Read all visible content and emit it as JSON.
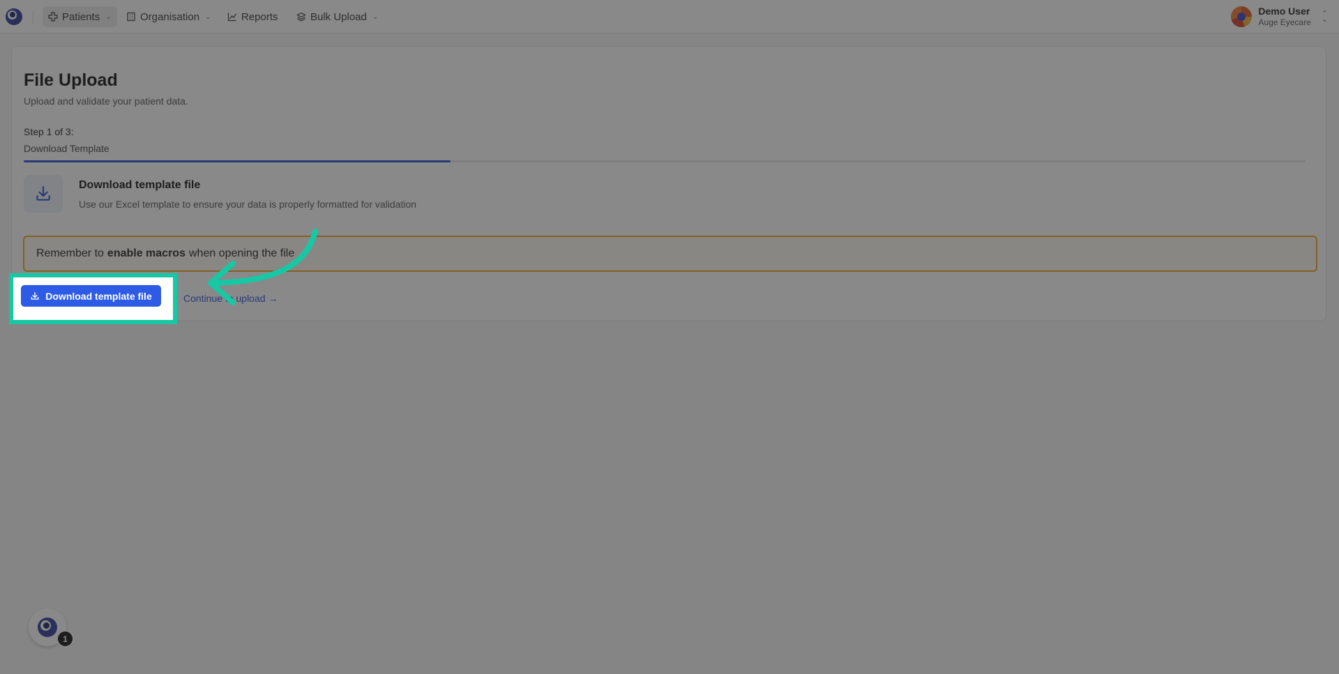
{
  "nav": {
    "items": [
      {
        "label": "Patients",
        "icon": "plus-cross-icon",
        "has_dropdown": true,
        "active": true
      },
      {
        "label": "Organisation",
        "icon": "building-icon",
        "has_dropdown": true,
        "active": false
      },
      {
        "label": "Reports",
        "icon": "chart-line-icon",
        "has_dropdown": false,
        "active": false
      },
      {
        "label": "Bulk Upload",
        "icon": "layers-icon",
        "has_dropdown": true,
        "active": false
      }
    ],
    "user": {
      "name": "Demo User",
      "org": "Auge Eyecare"
    }
  },
  "page": {
    "title": "File Upload",
    "subtitle": "Upload and validate your patient data.",
    "step_label": "Step 1 of 3:",
    "step_name": "Download Template",
    "progress": 0.333
  },
  "download": {
    "title": "Download template file",
    "description": "Use our Excel template to ensure your data is properly formatted for validation"
  },
  "notice": {
    "prefix": "Remember to",
    "bold": "enable macros",
    "suffix": "when opening the file"
  },
  "actions": {
    "download_button": "Download template file",
    "continue_link": "Continue to upload →"
  },
  "help_widget": {
    "badge_count": "1"
  },
  "colors": {
    "accent": "#2d5be6",
    "highlight": "#16c8a4",
    "notice_border": "#f4a51c"
  }
}
